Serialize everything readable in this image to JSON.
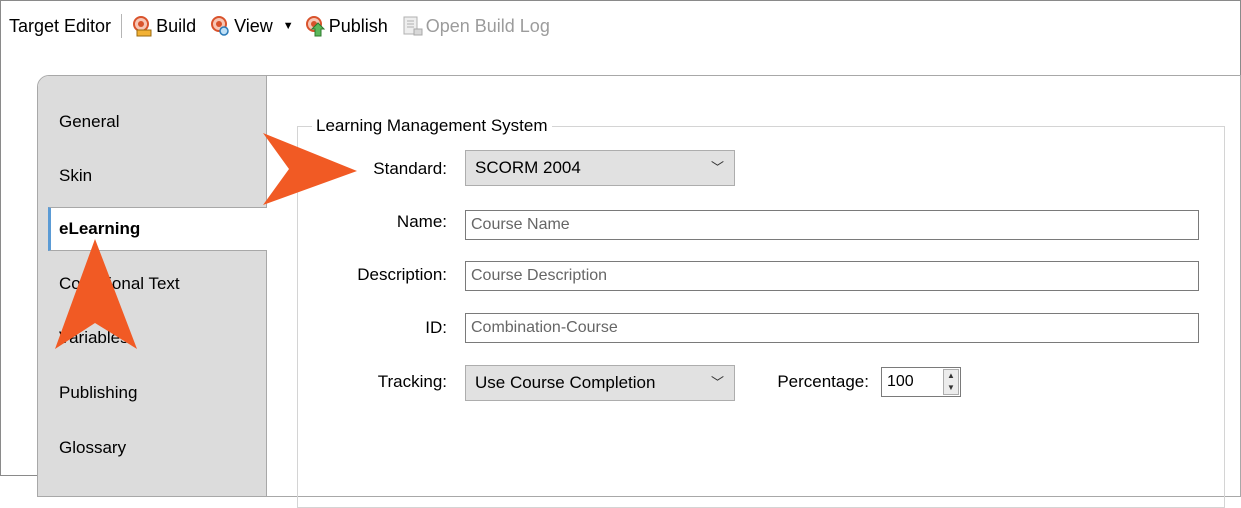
{
  "toolbar": {
    "title": "Target Editor",
    "build_label": "Build",
    "view_label": "View",
    "publish_label": "Publish",
    "open_build_log_label": "Open Build Log"
  },
  "tabs": [
    {
      "label": "General"
    },
    {
      "label": "Skin"
    },
    {
      "label": "eLearning",
      "active": true
    },
    {
      "label": "Conditional Text"
    },
    {
      "label": "Variables"
    },
    {
      "label": "Publishing"
    },
    {
      "label": "Glossary"
    }
  ],
  "lms": {
    "group_title": "Learning Management System",
    "standard_label": "Standard:",
    "standard_value": "SCORM 2004",
    "name_label": "Name:",
    "name_placeholder": "Course Name",
    "description_label": "Description:",
    "description_placeholder": "Course Description",
    "id_label": "ID:",
    "id_placeholder": "Combination-Course",
    "tracking_label": "Tracking:",
    "tracking_value": "Use Course Completion",
    "percentage_label": "Percentage:",
    "percentage_value": "100"
  },
  "colors": {
    "callout_arrow": "#f15a24",
    "active_tab_accent": "#5b9bd5",
    "tab_strip_bg": "#dcdcdc"
  },
  "icons": {
    "build": "build-icon",
    "view": "view-icon",
    "publish": "publish-icon",
    "open_build_log": "build-log-icon"
  }
}
